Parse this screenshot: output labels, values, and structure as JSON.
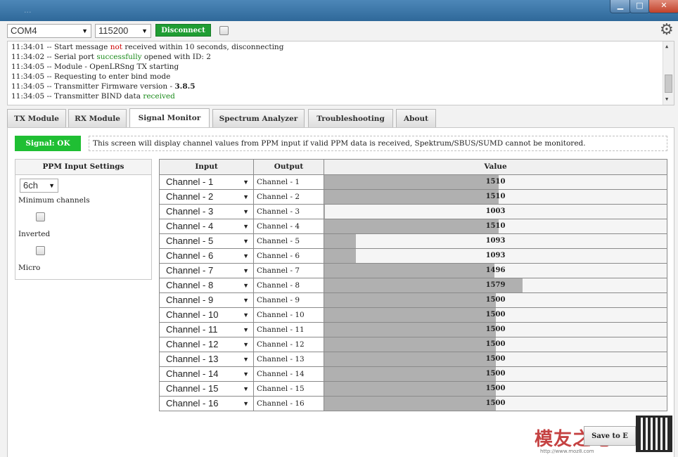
{
  "window": {
    "title": "..."
  },
  "toolbar": {
    "port": "COM4",
    "baud": "115200",
    "connect_label": "Disconnect"
  },
  "log": [
    {
      "time": "11:34:01",
      "parts": [
        {
          "t": " -- Start message "
        },
        {
          "t": "not",
          "c": "red"
        },
        {
          "t": " received within 10 seconds, disconnecting"
        }
      ]
    },
    {
      "time": "11:34:02",
      "parts": [
        {
          "t": " -- Serial port "
        },
        {
          "t": "successfully",
          "c": "green"
        },
        {
          "t": " opened with ID: 2"
        }
      ]
    },
    {
      "time": "11:34:05",
      "parts": [
        {
          "t": " -- Module - OpenLRSng TX starting"
        }
      ]
    },
    {
      "time": "11:34:05",
      "parts": [
        {
          "t": " -- Requesting to enter bind mode"
        }
      ]
    },
    {
      "time": "11:34:05",
      "parts": [
        {
          "t": " -- Transmitter Firmware version - "
        },
        {
          "t": "3.8.5",
          "c": "bold"
        }
      ]
    },
    {
      "time": "11:34:05",
      "parts": [
        {
          "t": " -- Transmitter BIND data "
        },
        {
          "t": "received",
          "c": "green"
        }
      ]
    }
  ],
  "tabs": [
    {
      "label": "TX Module",
      "active": false
    },
    {
      "label": "RX Module",
      "active": false
    },
    {
      "label": "Signal Monitor",
      "active": true
    },
    {
      "label": "Spectrum Analyzer",
      "active": false
    },
    {
      "label": "Troubleshooting",
      "active": false
    },
    {
      "label": "About",
      "active": false
    }
  ],
  "signal": {
    "status": "Signal: OK",
    "info": "This screen will display channel values from PPM input if valid PPM data is received, Spektrum/SBUS/SUMD cannot be monitored."
  },
  "ppm": {
    "title": "PPM Input Settings",
    "channels_value": "6ch",
    "min_channels_label": "Minimum channels",
    "inverted_label": "Inverted",
    "micro_label": "Micro"
  },
  "table": {
    "headers": {
      "input": "Input",
      "output": "Output",
      "value": "Value"
    },
    "value_range": [
      1000,
      2000
    ],
    "rows": [
      {
        "input": "Channel - 1",
        "output": "Channel - 1",
        "value": 1510
      },
      {
        "input": "Channel - 2",
        "output": "Channel - 2",
        "value": 1510
      },
      {
        "input": "Channel - 3",
        "output": "Channel - 3",
        "value": 1003
      },
      {
        "input": "Channel - 4",
        "output": "Channel - 4",
        "value": 1510
      },
      {
        "input": "Channel - 5",
        "output": "Channel - 5",
        "value": 1093
      },
      {
        "input": "Channel - 6",
        "output": "Channel - 6",
        "value": 1093
      },
      {
        "input": "Channel - 7",
        "output": "Channel - 7",
        "value": 1496
      },
      {
        "input": "Channel - 8",
        "output": "Channel - 8",
        "value": 1579
      },
      {
        "input": "Channel - 9",
        "output": "Channel - 9",
        "value": 1500
      },
      {
        "input": "Channel - 10",
        "output": "Channel - 10",
        "value": 1500
      },
      {
        "input": "Channel - 11",
        "output": "Channel - 11",
        "value": 1500
      },
      {
        "input": "Channel - 12",
        "output": "Channel - 12",
        "value": 1500
      },
      {
        "input": "Channel - 13",
        "output": "Channel - 13",
        "value": 1500
      },
      {
        "input": "Channel - 14",
        "output": "Channel - 14",
        "value": 1500
      },
      {
        "input": "Channel - 15",
        "output": "Channel - 15",
        "value": 1500
      },
      {
        "input": "Channel - 16",
        "output": "Channel - 16",
        "value": 1500
      }
    ]
  },
  "save_label": "Save to E",
  "watermark": {
    "text": "模友之吧",
    "url": "http://www.moz8.com"
  }
}
